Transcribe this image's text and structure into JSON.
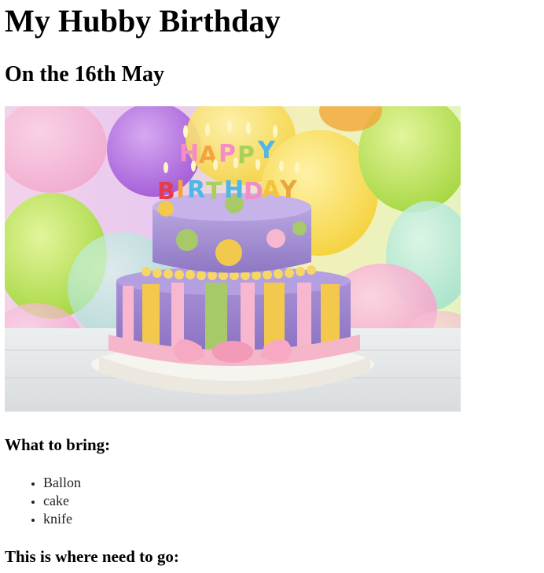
{
  "page": {
    "title": "My Hubby Birthday",
    "subtitle": "On the 16th May",
    "image": {
      "name": "birthday-cake-photo",
      "candle_letters": [
        "H",
        "A",
        "P",
        "P",
        "Y",
        "B",
        "I",
        "R",
        "T",
        "H",
        "D",
        "A",
        "Y"
      ]
    },
    "bring_heading": "What to bring:",
    "bring_items": [
      "Ballon",
      "cake",
      "knife"
    ],
    "where_heading": "This is where need to go:"
  },
  "colors": {
    "text": "#000000",
    "cake_purple": "#9b86c9",
    "ribbon_pink": "#f4b6c8",
    "stripe_yellow": "#f2c94c",
    "stripe_green": "#a8c96a"
  }
}
